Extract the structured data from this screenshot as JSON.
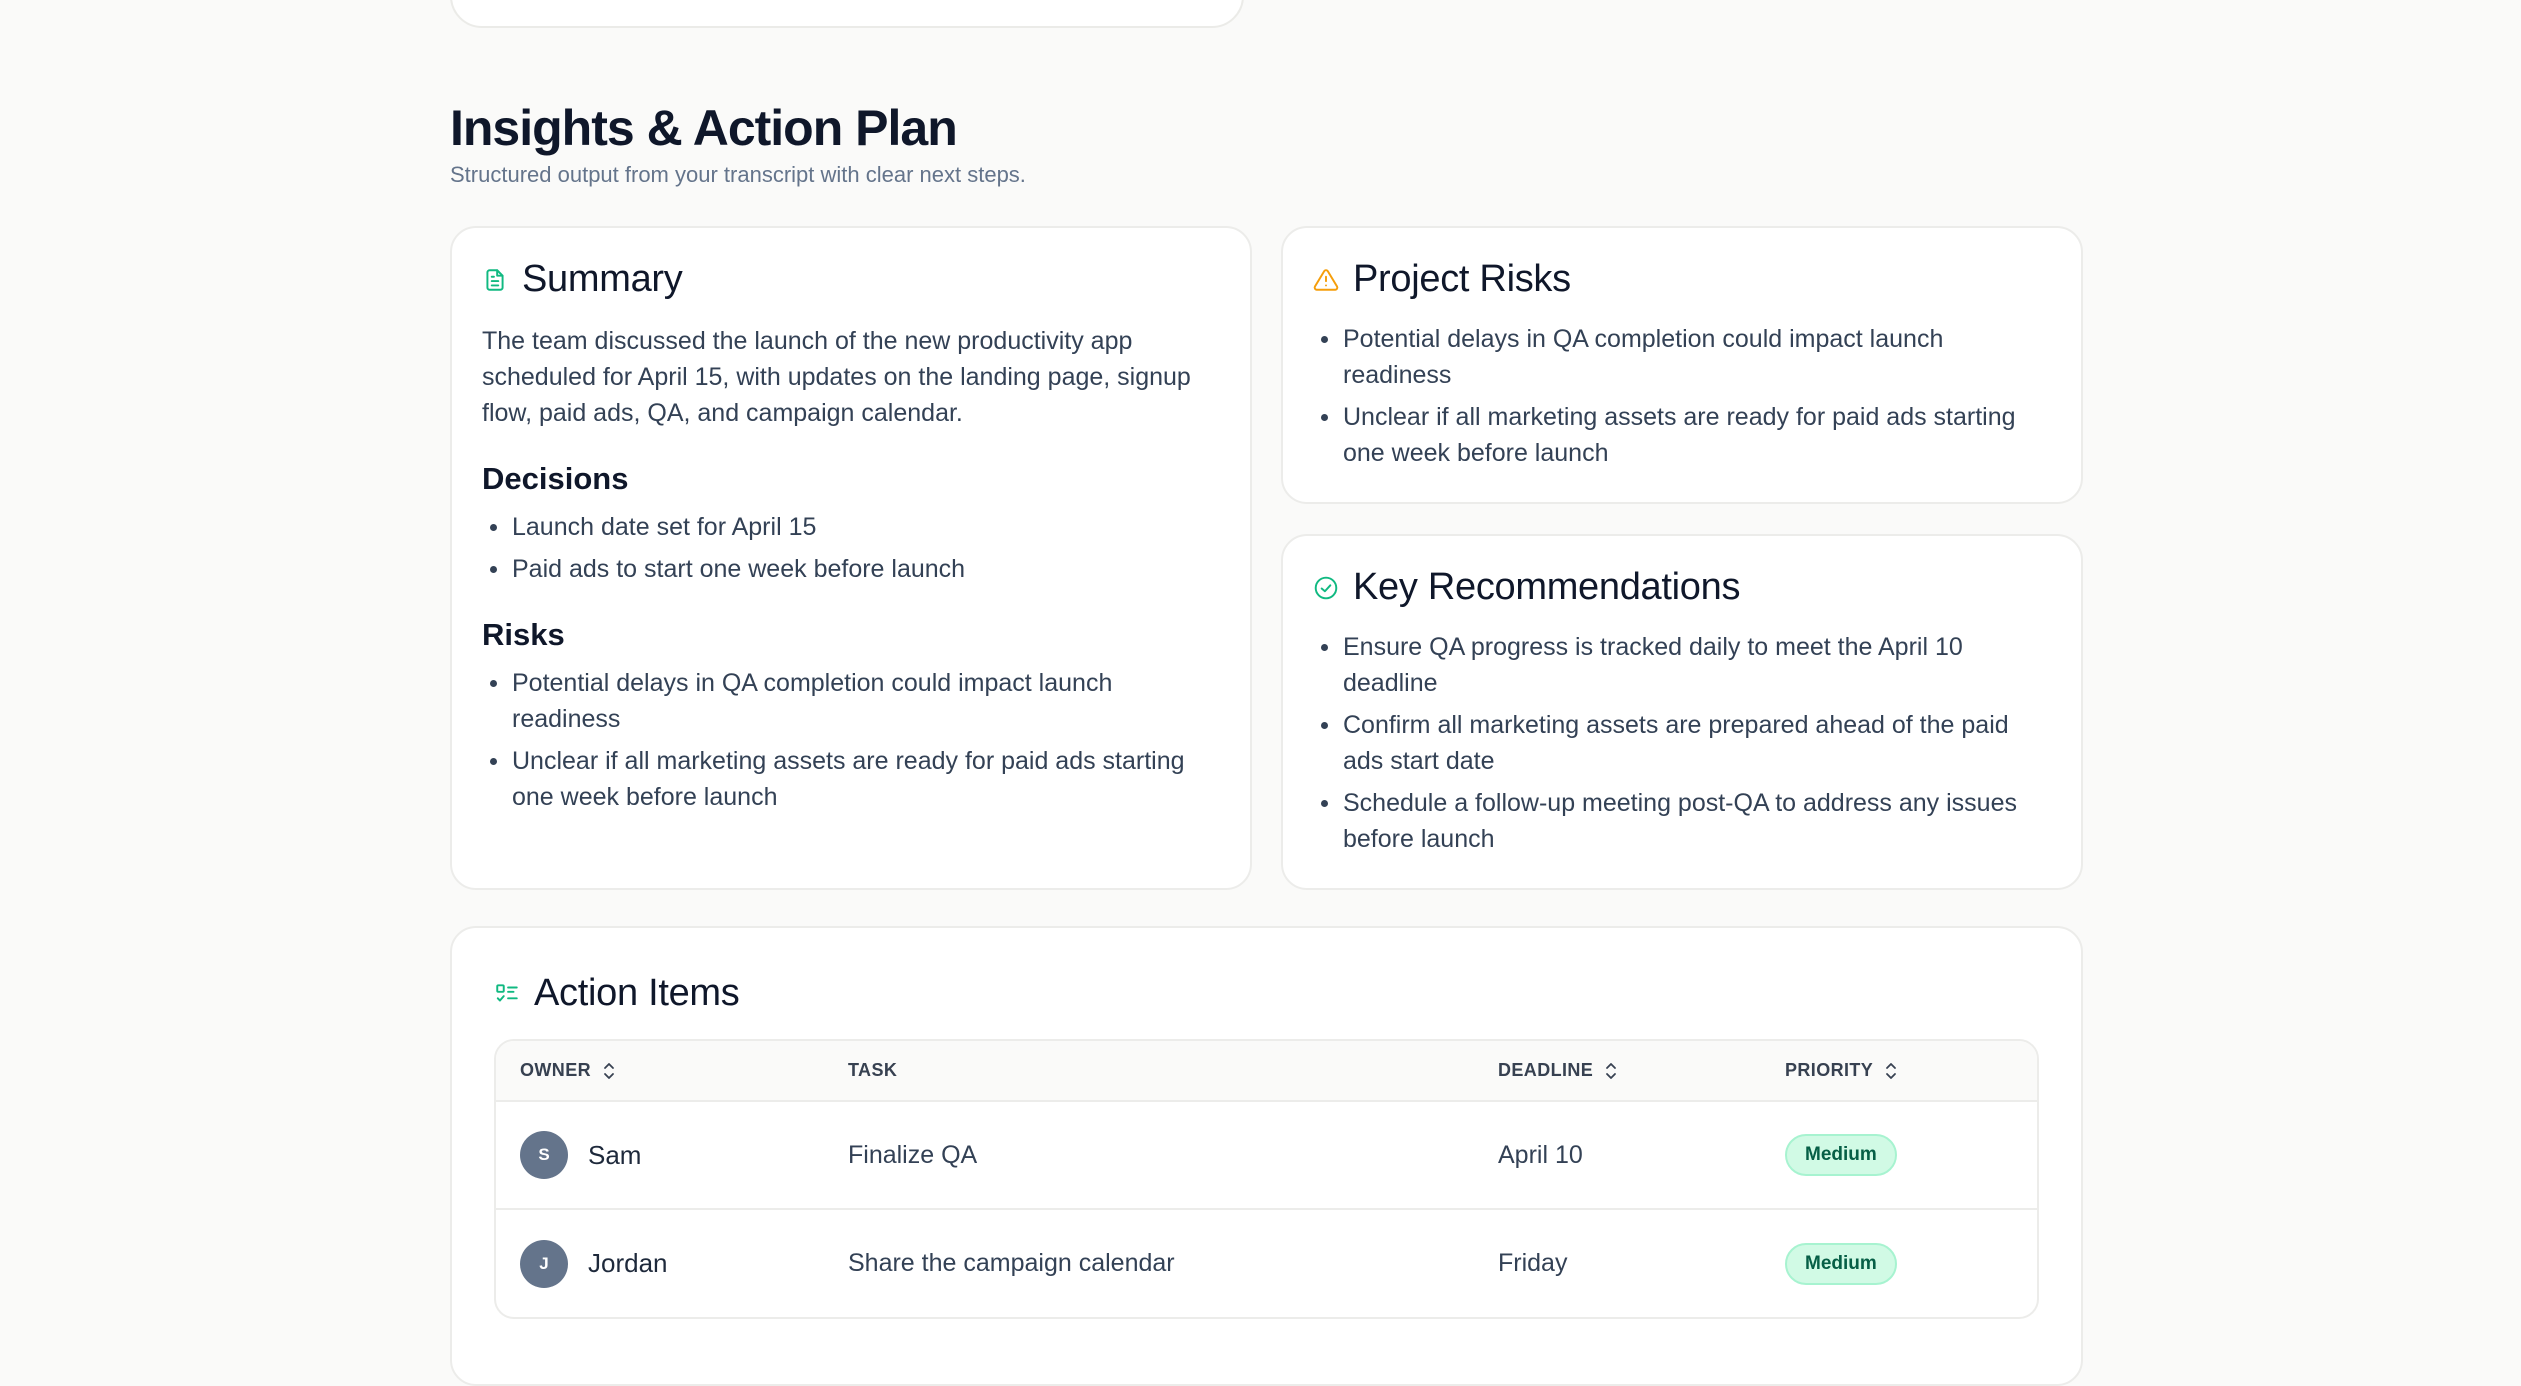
{
  "section": {
    "title": "Insights & Action Plan",
    "subtitle": "Structured output from your transcript with clear next steps."
  },
  "summary": {
    "title": "Summary",
    "icon": "document-icon",
    "text": "The team discussed the launch of the new productivity app scheduled for April 15, with updates on the landing page, signup flow, paid ads, QA, and campaign calendar.",
    "decisions_heading": "Decisions",
    "decisions": [
      "Launch date set for April 15",
      "Paid ads to start one week before launch"
    ],
    "risks_heading": "Risks",
    "risks": [
      "Potential delays in QA completion could impact launch readiness",
      "Unclear if all marketing assets are ready for paid ads starting one week before launch"
    ]
  },
  "project_risks": {
    "title": "Project Risks",
    "icon": "warning-icon",
    "items": [
      "Potential delays in QA completion could impact launch readiness",
      "Unclear if all marketing assets are ready for paid ads starting one week before launch"
    ]
  },
  "recommendations": {
    "title": "Key Recommendations",
    "icon": "check-circle-icon",
    "items": [
      "Ensure QA progress is tracked daily to meet the April 10 deadline",
      "Confirm all marketing assets are prepared ahead of the paid ads start date",
      "Schedule a follow-up meeting post-QA to address any issues before launch"
    ]
  },
  "action_items": {
    "title": "Action Items",
    "icon": "checklist-icon",
    "columns": {
      "owner": "OWNER",
      "task": "TASK",
      "deadline": "DEADLINE",
      "priority": "PRIORITY"
    },
    "rows": [
      {
        "initial": "S",
        "owner": "Sam",
        "task": "Finalize QA",
        "deadline": "April 10",
        "priority": "Medium"
      },
      {
        "initial": "J",
        "owner": "Jordan",
        "task": "Share the campaign calendar",
        "deadline": "Friday",
        "priority": "Medium"
      }
    ]
  },
  "colors": {
    "accent_green": "#10b981",
    "warning_orange": "#f59e0b",
    "badge_bg": "#d1fae5",
    "badge_text": "#065f46",
    "avatar_bg": "#64748b"
  }
}
